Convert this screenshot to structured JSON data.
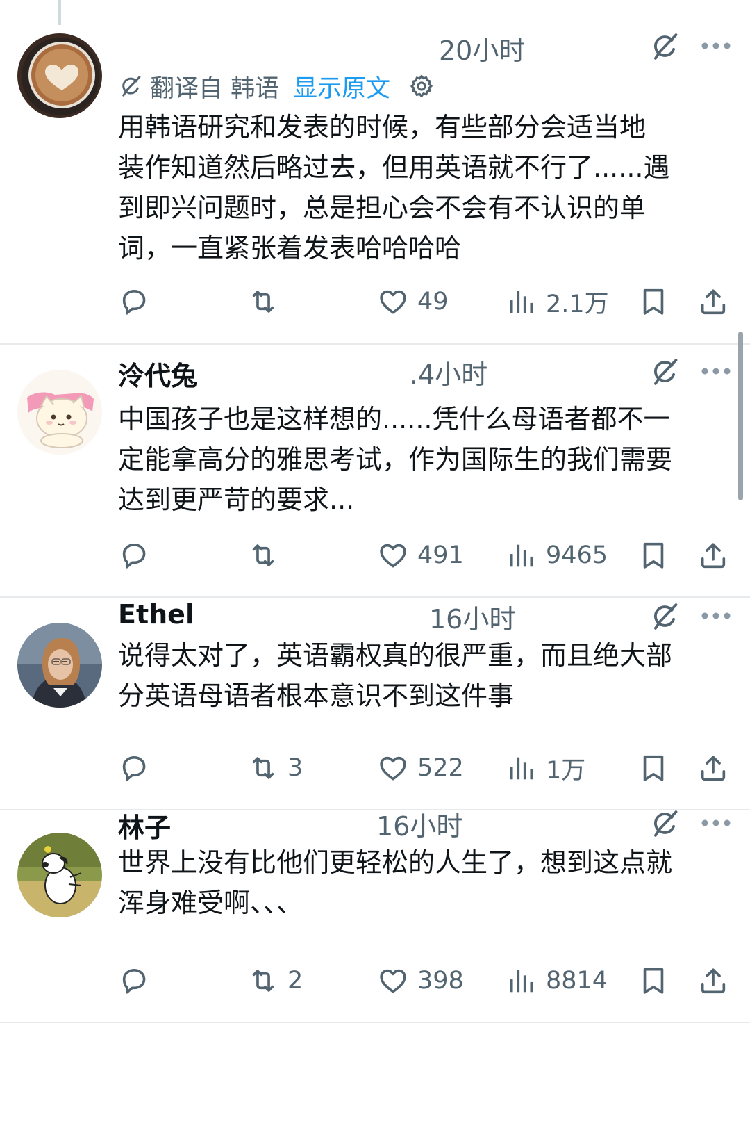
{
  "tweets": [
    {
      "author": "",
      "time": "20小时",
      "translation": {
        "label": "翻译自 韩语",
        "show_original": "显示原文"
      },
      "lines": [
        "用韩语研究和发表的时候，有些部分会适当地",
        "装作知道然后略过去，但用英语就不行了......遇",
        "到即兴问题时，总是担心会不会有不认识的单",
        "词，一直紧张着发表哈哈哈哈"
      ],
      "replies": "",
      "retweets": "",
      "likes": "49",
      "views": "2.1万"
    },
    {
      "author": "泠代兔",
      "time": ".4小时",
      "lines": [
        "中国孩子也是这样想的......凭什么母语者都不一",
        "定能拿高分的雅思考试，作为国际生的我们需要",
        "达到更严苛的要求..."
      ],
      "replies": "",
      "retweets": "",
      "likes": "491",
      "views": "9465"
    },
    {
      "author": "Ethel",
      "time": "16小时",
      "lines": [
        "说得太对了，英语霸权真的很严重，而且绝大部",
        "分英语母语者根本意识不到这件事"
      ],
      "replies": "",
      "retweets": "3",
      "likes": "522",
      "views": "1万"
    },
    {
      "author": "林子",
      "time": "16小时",
      "lines": [
        "世界上没有比他们更轻松的人生了，想到这点就",
        "浑身难受啊、、、"
      ],
      "replies": "",
      "retweets": "2",
      "likes": "398",
      "views": "8814"
    }
  ],
  "icons": {
    "reply": "reply-icon",
    "retweet": "retweet-icon",
    "like": "heart-icon",
    "views": "views-icon",
    "bookmark": "bookmark-icon",
    "share": "share-icon",
    "grok": "grok-icon",
    "more": "more-icon",
    "settings": "gear-icon"
  },
  "colors": {
    "text": "#0f1419",
    "secondary": "#536471",
    "link": "#1d9bf0",
    "divider": "#e7ebee"
  }
}
